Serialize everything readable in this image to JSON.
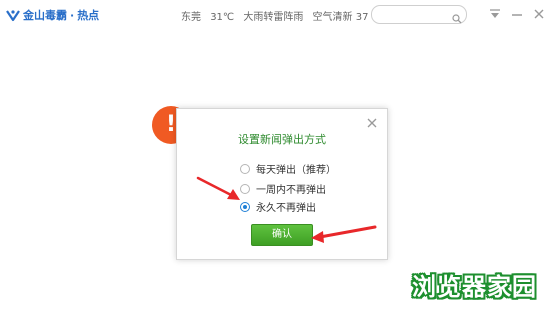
{
  "header": {
    "brand_name": "金山毒霸",
    "brand_sep": "·",
    "brand_section": "热点",
    "weather": {
      "city": "东莞",
      "temperature": "31℃",
      "condition": "大雨转雷阵雨",
      "air_quality": "空气清新 37"
    },
    "search": {
      "value": "",
      "placeholder": ""
    }
  },
  "dialog": {
    "title": "设置新闻弹出方式",
    "options": [
      {
        "label": "每天弹出（推荐）",
        "checked": false
      },
      {
        "label": "一周内不再弹出",
        "checked": false
      },
      {
        "label": "永久不再弹出",
        "checked": true
      }
    ],
    "confirm_label": "确认"
  },
  "badge": {
    "symbol": "!"
  },
  "watermark": "浏览器家园",
  "colors": {
    "brand": "#2a6fc9",
    "accent_green": "#3e9f24",
    "title_green": "#2d8a2d",
    "arrow_red": "#e8282a",
    "badge_orange": "#f05a23",
    "radio_blue": "#1f7fd6"
  }
}
